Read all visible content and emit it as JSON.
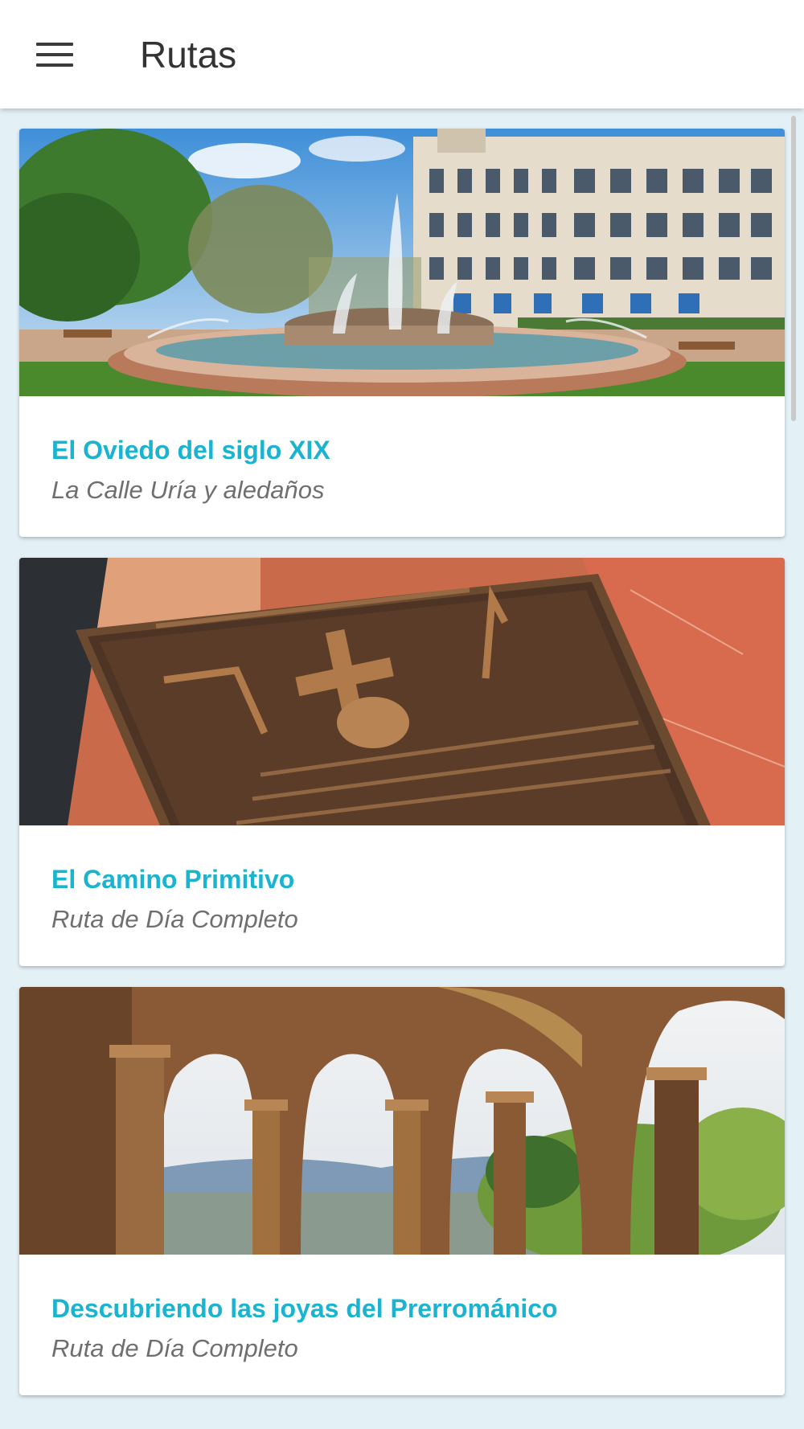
{
  "appbar": {
    "title": "Rutas",
    "menu_icon": "hamburger-menu-icon"
  },
  "routes": [
    {
      "title": "El Oviedo del siglo XIX",
      "subtitle": "La Calle Uría y aledaños",
      "image": "fountain-and-historic-building-photo"
    },
    {
      "title": "El Camino Primitivo",
      "subtitle": "Ruta de Día Completo",
      "image": "camino-de-santiago-plaque-photo"
    },
    {
      "title": "Descubriendo las joyas del Prerrománico",
      "subtitle": "Ruta de Día Completo",
      "image": "prerromanico-arches-photo"
    }
  ],
  "colors": {
    "accent": "#1ab3d0",
    "background": "#e3f0f6",
    "subtitle": "#6f6f6f"
  }
}
